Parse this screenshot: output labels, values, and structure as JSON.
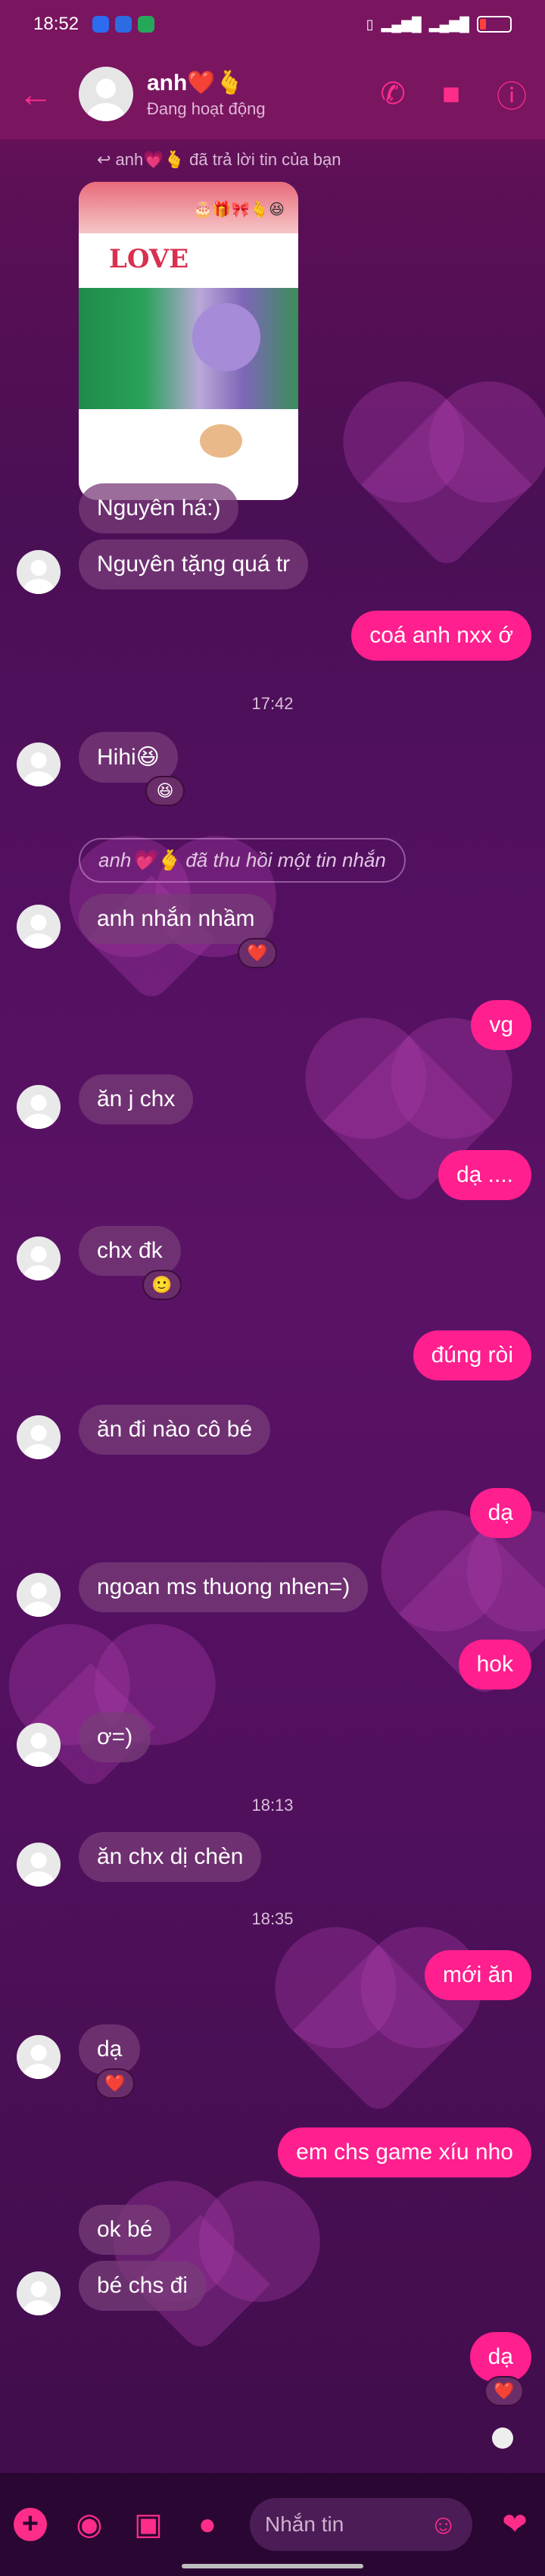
{
  "status_bar": {
    "time": "18:52"
  },
  "header": {
    "contact_name": "anh❤️🫰",
    "contact_status": "Đang hoạt động"
  },
  "colors": {
    "accent": "#ff1f8e",
    "header_bg": "#7a1560"
  },
  "messages": {
    "reply_note": "↩ anh💗🫰 đã trả lời tin của bạn",
    "sticker_text": "LOVE",
    "sticker_tiny": "🎂🎁🎀🫰😆",
    "m1": "Nguyên há:)",
    "m2": "Nguyên tặng quá tr",
    "m3": "coá anh nxx ớ",
    "ts1": "17:42",
    "m4": "Hihi😆",
    "r4": "😆",
    "recalled": "anh💗🫰 đã thu hồi một tin nhắn",
    "m5": "anh nhắn nhầm",
    "r5": "❤️",
    "m6": "vg",
    "m7": "ăn j chx",
    "m8": "dạ ....",
    "m9": "chx đk",
    "r9": "🙂",
    "m10": "đúng ròi",
    "m11": "ăn đi nào cô bé",
    "m12": "dạ",
    "m13": "ngoan ms thuong nhen=)",
    "m14": "hok",
    "m15": "ơ=)",
    "ts2": "18:13",
    "m16": "ăn chx dị chèn",
    "ts3": "18:35",
    "m17": "mới ăn",
    "m18": "dạ",
    "r18": "❤️",
    "m19": "em chs game xíu nho",
    "m20": "ok bé",
    "m21": "bé chs đi",
    "m22": "dạ",
    "r22": "❤️"
  },
  "composer": {
    "placeholder": "Nhắn tin"
  }
}
